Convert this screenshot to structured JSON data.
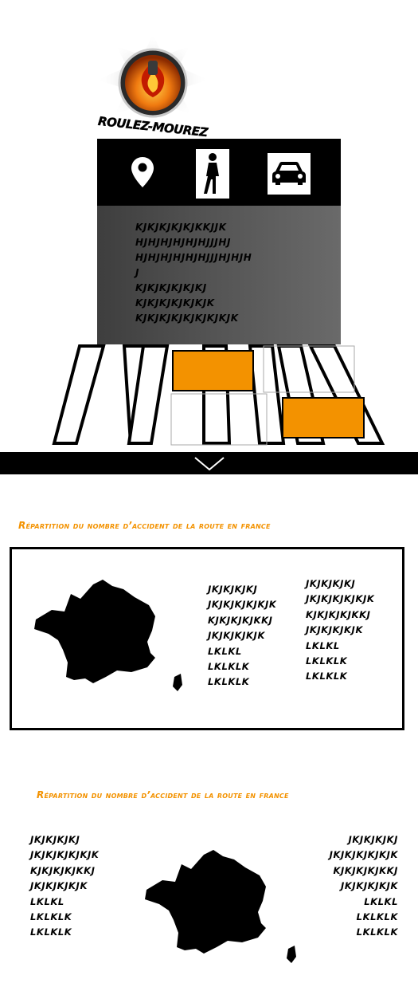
{
  "logo": {
    "text": "ROULEZ-MOUREZ",
    "colors": {
      "flame": "#f39200",
      "ring": "#2a2a2a",
      "rim": "#c9c9c9"
    }
  },
  "icon_bar": {
    "icons": [
      {
        "name": "location-pin-icon"
      },
      {
        "name": "pedestrian-icon"
      },
      {
        "name": "car-icon"
      }
    ]
  },
  "content_box": {
    "lines": [
      "KJKJKJKJKJKKJJK",
      "HJHJHJHJHJHJJJHJ",
      "HJHJHJHJHJHJJJHJHJH",
      "J",
      "KJKJKJKJKJKJ",
      "KJKJKJKJKJKJK",
      "KJKJKJKJKJKJKJKJK"
    ]
  },
  "scroll": {
    "icon": "chevron-down-icon"
  },
  "section1": {
    "title": "Répartition du nombre d’accident de la route en france",
    "col_left": [
      "JKJKJKJKJ",
      "JKJKJKJKJKJK",
      "KJKJKJKJKKJ",
      "JKJKJKJKJK",
      "LKLKL",
      "LKLKLK",
      "LKLKLK"
    ],
    "col_right": [
      "JKJKJKJKJ",
      "JKJKJKJKJKJK",
      "KJKJKJKJKKJ",
      "JKJKJKJKJK",
      "LKLKL",
      "LKLKLK",
      "LKLKLK"
    ]
  },
  "section2": {
    "title": "Répartition du nombre d’accident de la route en france",
    "col_left": [
      "JKJKJKJKJ",
      "JKJKJKJKJKJK",
      "KJKJKJKJKKJ",
      "JKJKJKJKJK",
      "LKLKL",
      "LKLKLK",
      "LKLKLK"
    ],
    "col_right": [
      "JKJKJKJKJ",
      "JKJKJKJKJKJK",
      "KJKJKJKJKKJ",
      "JKJKJKJKJK",
      "LKLKL",
      "LKLKLK",
      "LKLKLK"
    ]
  },
  "colors": {
    "accent": "#f39200",
    "dark": "#000000"
  }
}
